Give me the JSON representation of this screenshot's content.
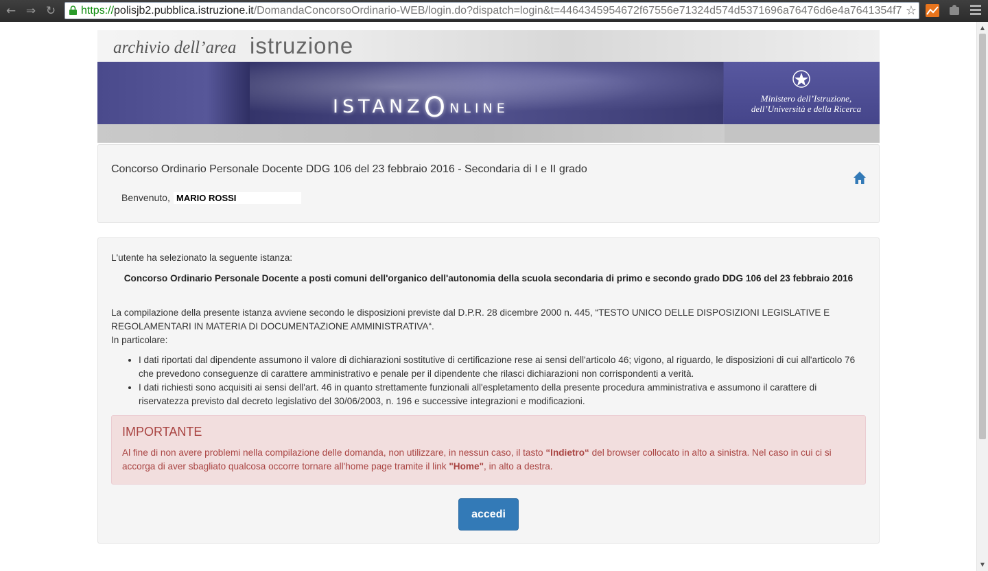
{
  "browser": {
    "url_scheme": "https://",
    "url_host": "polisjb2.pubblica.istruzione.it",
    "url_path": "/DomandaConcorsoOrdinario-WEB/login.do?dispatch=login&t=4464345954672f67556e71324d574d5371696a76476d6e4a7641354f7",
    "back_icon": "back-arrow-icon",
    "forward_icon": "forward-arrow-icon",
    "reload_icon": "reload-icon",
    "bookmark_icon": "star-icon"
  },
  "header": {
    "archivio": "archivio dell’area",
    "istruzione": "istruzione",
    "banner_text": "ISTANZ",
    "banner_o": "O",
    "banner_nline": "NLINE",
    "ministero_line1": "Ministero dell’Istruzione,",
    "ministero_line2": "dell’Università e della Ricerca"
  },
  "top_panel": {
    "title": "Concorso Ordinario Personale Docente DDG 106 del 23 febbraio 2016 - Secondaria di I e II grado",
    "welcome_label": "Benvenuto,",
    "user_name": "MARIO ROSSI",
    "home_icon": "home-icon"
  },
  "main": {
    "intro": "L'utente ha selezionato la seguente istanza:",
    "istanza_title": "Concorso Ordinario Personale Docente a posti comuni dell'organico dell'autonomia della scuola secondaria di primo e secondo grado DDG 106 del 23 febbraio 2016",
    "compilazione": "La compilazione della presente istanza avviene secondo le disposizioni previste dal D.P.R. 28 dicembre 2000 n. 445, “TESTO UNICO DELLE DISPOSIZIONI LEGISLATIVE E REGOLAMENTARI IN MATERIA DI DOCUMENTAZIONE AMMINISTRATIVA“.",
    "particolare": "In particolare:",
    "bullets": [
      "I dati riportati dal dipendente assumono il valore di dichiarazioni sostitutive di certificazione rese ai sensi dell'articolo 46; vigono, al riguardo, le disposizioni di cui all'articolo 76 che prevedono conseguenze di carattere amministrativo e penale per il dipendente che rilasci dichiarazioni non corrispondenti a verità.",
      "I dati richiesti sono acquisiti ai sensi dell'art. 46 in quanto strettamente funzionali all'espletamento della presente procedura amministrativa e assumono il carattere di riservatezza previsto dal decreto legislativo del 30/06/2003, n. 196 e successive integrazioni e modificazioni."
    ],
    "alert": {
      "title": "IMPORTANTE",
      "text_1": "Al fine di non avere problemi nella compilazione delle domanda, non utilizzare, in nessun caso, il tasto ",
      "indietro": "“Indietro“",
      "text_2": " del browser collocato in alto a sinistra. Nel caso in cui ci si accorga di aver sbagliato qualcosa occorre tornare all'home page tramite il link ",
      "home": "\"Home\"",
      "text_3": ", in alto a destra."
    },
    "accedi_label": "accedi"
  },
  "colors": {
    "primary_button": "#337ab7",
    "alert_bg": "#f2dede",
    "alert_text": "#a94442",
    "banner": "#4a4a8c"
  }
}
